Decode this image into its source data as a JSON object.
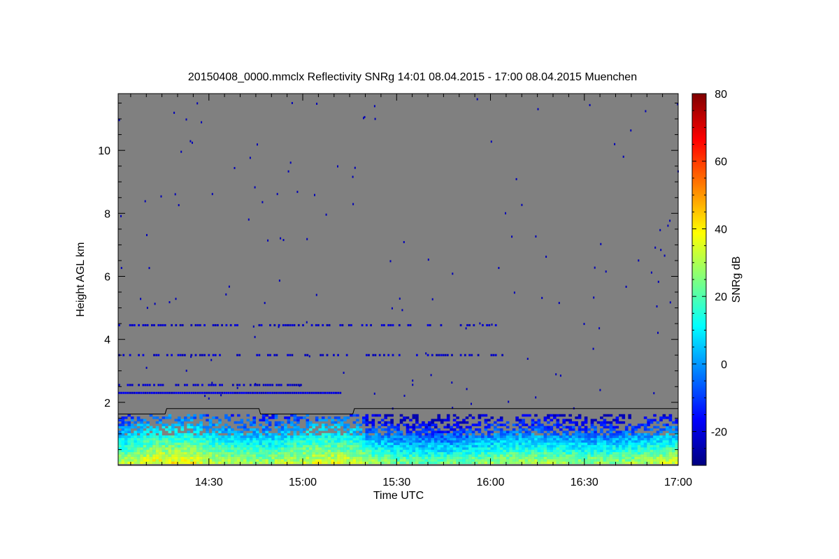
{
  "chart_data": {
    "type": "heatmap",
    "title": "20150408_0000.mmclx Reflectivity SNRg   14:01 08.04.2015 - 17:00 08.04.2015 Muenchen",
    "xlabel": "Time UTC",
    "ylabel": "Height AGL km",
    "colorbar_label": "SNRg dB",
    "x_tick_labels": [
      "14:30",
      "15:00",
      "15:30",
      "16:00",
      "16:30",
      "17:00"
    ],
    "x_ticks_minutes": [
      870,
      900,
      930,
      960,
      990,
      1020
    ],
    "xlim_minutes": [
      841,
      1020
    ],
    "y_ticks": [
      2,
      4,
      6,
      8,
      10
    ],
    "ylim": [
      0,
      11.8
    ],
    "colorbar_ticks": [
      -20,
      0,
      20,
      40,
      60,
      80
    ],
    "colorbar_range": [
      -30,
      80
    ],
    "colormap": [
      "#00007f",
      "#0000ff",
      "#007fff",
      "#00ffff",
      "#7fff7f",
      "#ffff00",
      "#ff7f00",
      "#ff0000",
      "#7f0000"
    ],
    "background_color": "#808080",
    "grid": false,
    "cloud_base_line": {
      "times_minutes": [
        841,
        856,
        856.5,
        886,
        886.5,
        916,
        916.5,
        1020
      ],
      "heights_km": [
        1.63,
        1.63,
        1.8,
        1.8,
        1.63,
        1.63,
        1.8,
        1.8
      ]
    },
    "echo_layers": [
      {
        "height_km": 4.45,
        "t_start": 841,
        "t_end": 964,
        "snr_db": -22
      },
      {
        "height_km": 3.5,
        "t_start": 841,
        "t_end": 965,
        "snr_db": -22
      },
      {
        "height_km": 2.55,
        "t_start": 841,
        "t_end": 900,
        "snr_db": -22
      },
      {
        "height_km": 2.3,
        "t_start": 841,
        "t_end": 912,
        "snr_db": -20
      }
    ],
    "boundary_layer": {
      "top_km": 1.6,
      "snr_range_db": [
        -25,
        40
      ]
    }
  }
}
